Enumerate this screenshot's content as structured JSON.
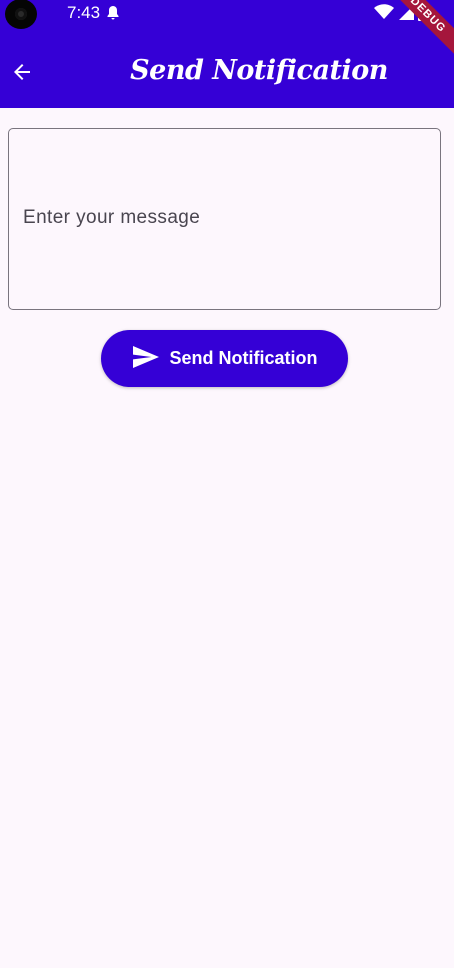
{
  "status_bar": {
    "time": "7:43",
    "debug_label": "DEBUG"
  },
  "app_bar": {
    "title": "Send Notification",
    "back_icon": "arrow-back-icon",
    "background": "#3500d6"
  },
  "form": {
    "message_placeholder": "Enter your message",
    "message_value": ""
  },
  "send_button": {
    "label": "Send Notification",
    "icon": "send-icon",
    "color": "#3500d6"
  }
}
